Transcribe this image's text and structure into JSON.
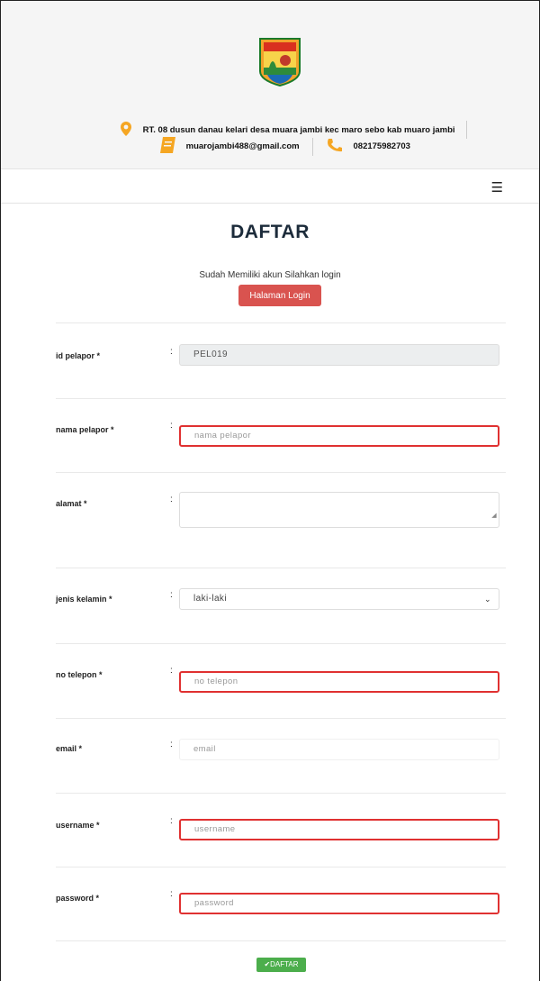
{
  "header": {
    "address": "RT. 08 dusun danau kelari desa muara jambi kec maro sebo kab muaro jambi",
    "email": "muarojambi488@gmail.com",
    "phone": "082175982703"
  },
  "page": {
    "title": "DAFTAR",
    "subtitle": "Sudah Memiliki akun Silahkan login",
    "login_button": "Halaman Login",
    "submit_button": "DAFTAR"
  },
  "form": {
    "colon": ":",
    "id_pelapor": {
      "label": "id pelapor *",
      "value": "PEL019"
    },
    "nama_pelapor": {
      "label": "nama pelapor *",
      "placeholder": "nama pelapor"
    },
    "alamat": {
      "label": "alamat *",
      "placeholder": ""
    },
    "jenis_kelamin": {
      "label": "jenis kelamin *",
      "selected": "laki-laki"
    },
    "no_telepon": {
      "label": "no telepon *",
      "placeholder": "no telepon"
    },
    "email": {
      "label": "email *",
      "placeholder": "email"
    },
    "username": {
      "label": "username *",
      "placeholder": "username"
    },
    "password": {
      "label": "password *",
      "placeholder": "password"
    }
  },
  "colors": {
    "error_border": "#e03131",
    "login_button": "#d9534f",
    "submit_button": "#4cae4c",
    "icon_orange": "#f5a623"
  }
}
